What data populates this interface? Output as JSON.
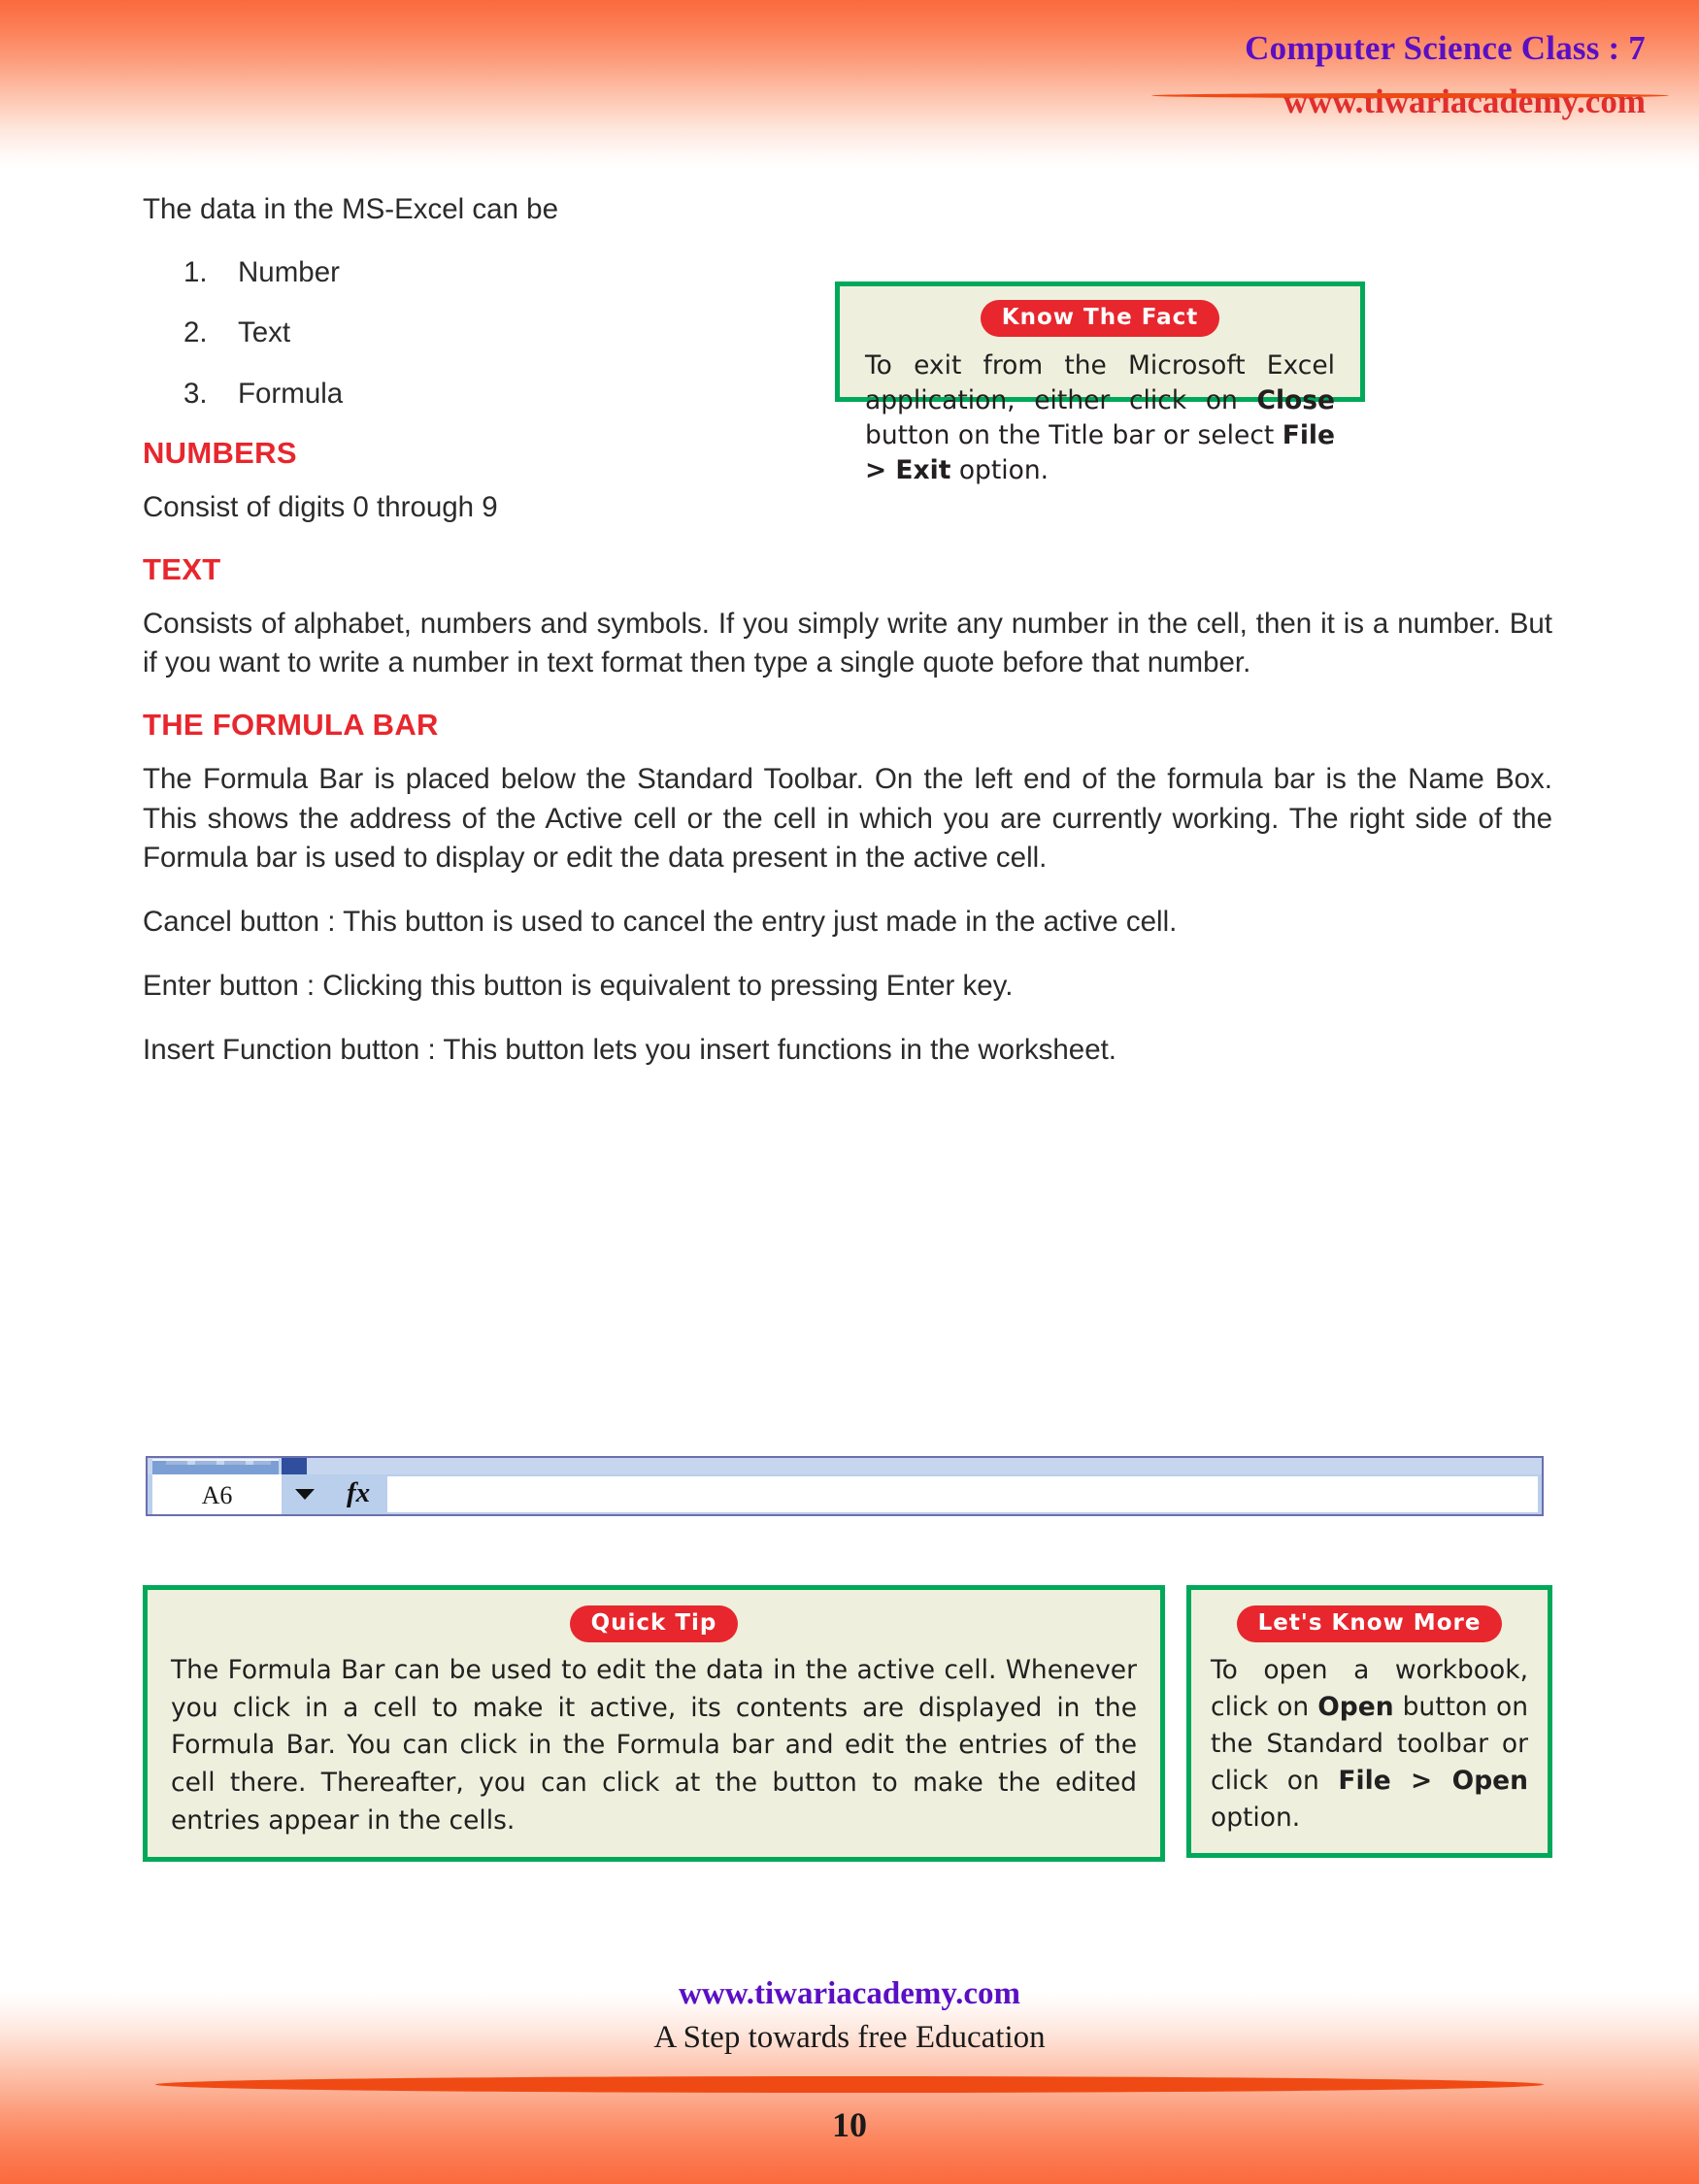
{
  "header": {
    "title": "Computer Science Class : 7",
    "url": "www.tiwariacademy.com"
  },
  "content": {
    "intro": "The data in the MS-Excel can be",
    "data_types": [
      {
        "num": "1.",
        "label": "Number"
      },
      {
        "num": "2.",
        "label": "Text"
      },
      {
        "num": "3.",
        "label": "Formula"
      }
    ],
    "numbers_heading": "NUMBERS",
    "numbers_text": "Consist of digits 0 through 9",
    "text_heading": "TEXT",
    "text_text": "Consists of alphabet, numbers and symbols. If you simply write any number in the cell, then it is a number. But if you want to write a number in text format then type a single quote before that number.",
    "formula_bar_heading": "THE FORMULA BAR",
    "formula_bar_text": "The Formula Bar is placed below the Standard Toolbar. On the left end of the formula bar is the Name Box. This shows the address of the Active cell or the cell in which you are currently working. The right side of the Formula bar is used to display or edit the data present in the active cell.",
    "cancel_button_text": "Cancel button : This button is used to cancel  the entry just made in the active cell.",
    "enter_button_text": "Enter button : Clicking this button is equivalent to pressing Enter key.",
    "insert_function_text": "Insert Function button : This button lets you insert functions in the worksheet."
  },
  "formula_bar_figure": {
    "name_box_value": "A6",
    "dropdown_glyph": "▾",
    "fx_label": "fx",
    "entry_value": ""
  },
  "know_fact_box": {
    "badge": "Know The Fact",
    "text_part1": "To exit from the Microsoft Excel application, either click on ",
    "bold1": "Close",
    "text_part2": " button on the Title bar or select ",
    "bold2": "File > Exit",
    "text_part3": " option."
  },
  "quick_tip_box": {
    "badge": "Quick Tip",
    "text": "The Formula Bar can be used to edit the data in the active cell. Whenever you click in a cell to make it active, its contents are displayed in the Formula Bar. You can click in the Formula bar and edit the entries of the cell there. Thereafter, you can click at the button to make the edited  entries appear in the cells."
  },
  "know_more_box": {
    "badge": "Let's Know More",
    "text_part1": "To open a workbook, click on ",
    "bold1": "Open",
    "text_part2": " button on the Standard toolbar or click on ",
    "bold2": "File > Open",
    "text_part3": " option."
  },
  "footer": {
    "url": "www.tiwariacademy.com",
    "tagline": "A Step towards free Education",
    "page_number": "10"
  },
  "colors": {
    "accent_orange": "#fb6a3f",
    "rule_orange": "#f04a14",
    "heading_red": "#e8262d",
    "badge_red": "#e8262d",
    "box_green": "#00a859",
    "box_cream": "#eef0dd",
    "title_purple": "#5b0fc4",
    "url_red": "#e02e2e"
  }
}
